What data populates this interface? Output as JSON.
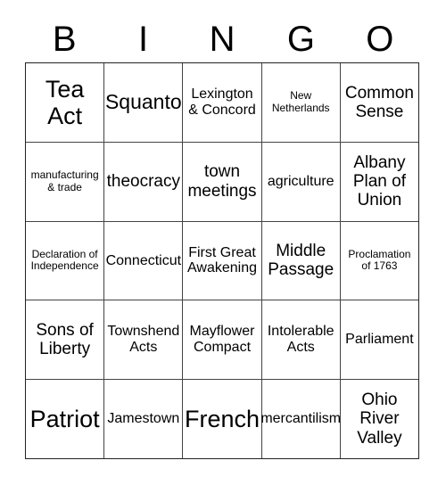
{
  "card": {
    "type": "bingo-card",
    "columns": 5,
    "rows": 5,
    "header_letters": [
      "B",
      "I",
      "N",
      "G",
      "O"
    ],
    "colors": {
      "background": "#ffffff",
      "text": "#000000",
      "grid_line": "#444444",
      "outer_border": "#222222"
    },
    "cells": [
      [
        {
          "text": "Tea Act",
          "size": "xl"
        },
        {
          "text": "Squanto",
          "size": "lg"
        },
        {
          "text": "Lexington & Concord",
          "size": "sm"
        },
        {
          "text": "New Netherlands",
          "size": "xs"
        },
        {
          "text": "Common Sense",
          "size": "md"
        }
      ],
      [
        {
          "text": "manufacturing & trade",
          "size": "xs"
        },
        {
          "text": "theocracy",
          "size": "md"
        },
        {
          "text": "town meetings",
          "size": "md"
        },
        {
          "text": "agriculture",
          "size": "sm"
        },
        {
          "text": "Albany Plan of Union",
          "size": "md"
        }
      ],
      [
        {
          "text": "Declaration of Independence",
          "size": "xs"
        },
        {
          "text": "Connecticut",
          "size": "sm"
        },
        {
          "text": "First Great Awakening",
          "size": "sm"
        },
        {
          "text": "Middle Passage",
          "size": "md"
        },
        {
          "text": "Proclamation of 1763",
          "size": "xs"
        }
      ],
      [
        {
          "text": "Sons of Liberty",
          "size": "md"
        },
        {
          "text": "Townshend Acts",
          "size": "sm"
        },
        {
          "text": "Mayflower Compact",
          "size": "sm"
        },
        {
          "text": "Intolerable Acts",
          "size": "sm"
        },
        {
          "text": "Parliament",
          "size": "sm"
        }
      ],
      [
        {
          "text": "Patriot",
          "size": "xl"
        },
        {
          "text": "Jamestown",
          "size": "sm"
        },
        {
          "text": "French",
          "size": "xl"
        },
        {
          "text": "mercantilism",
          "size": "sm"
        },
        {
          "text": "Ohio River Valley",
          "size": "md"
        }
      ]
    ]
  }
}
